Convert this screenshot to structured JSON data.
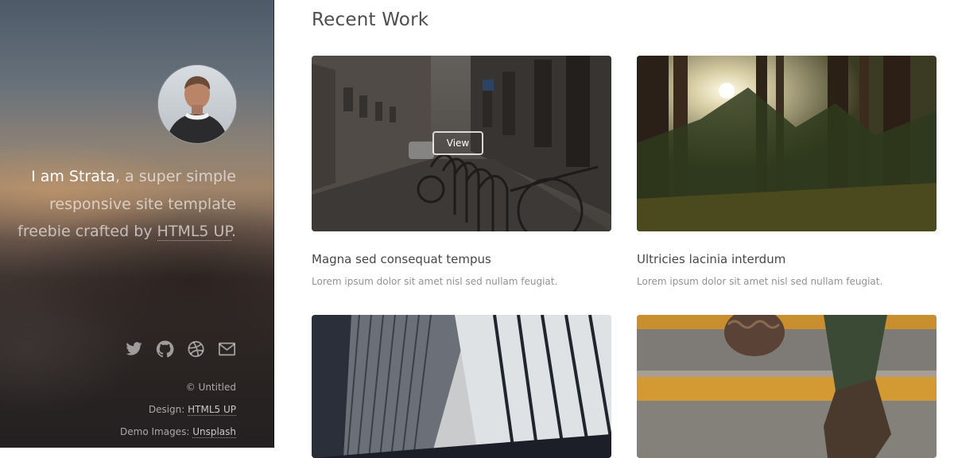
{
  "sidebar": {
    "intro": {
      "name": "I am Strata",
      "text_before_link": ", a super simple responsive site template freebie crafted by ",
      "link": "HTML5 UP",
      "text_after_link": "."
    },
    "social_icons": [
      "twitter-icon",
      "github-icon",
      "dribbble-icon",
      "envelope-icon"
    ],
    "credits": {
      "copyright": "© Untitled",
      "design_label": "Design: ",
      "design_link": "HTML5 UP",
      "images_label": "Demo Images: ",
      "images_link": "Unsplash"
    }
  },
  "main": {
    "title": "Recent Work",
    "view_button": "View",
    "items": [
      {
        "title": "Magna sed consequat tempus",
        "description": "Lorem ipsum dolor sit amet nisl sed nullam feugiat."
      },
      {
        "title": "Ultricies lacinia interdum",
        "description": "Lorem ipsum dolor sit amet nisl sed nullam feugiat."
      },
      {
        "title": "",
        "description": ""
      },
      {
        "title": "",
        "description": ""
      }
    ]
  }
}
